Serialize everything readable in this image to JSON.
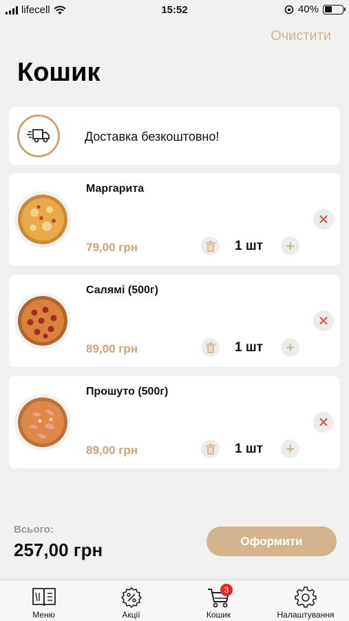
{
  "status": {
    "carrier": "lifecell",
    "time": "15:52",
    "battery": "40%",
    "battery_level": 0.4
  },
  "header": {
    "clear_label": "Очистити",
    "title": "Кошик"
  },
  "delivery": {
    "text": "Доставка безкоштовно!",
    "icon": "delivery-truck-icon"
  },
  "items": [
    {
      "name": "Маргарита",
      "price": "79,00 грн",
      "quantity": "1 шт",
      "style": "margherita"
    },
    {
      "name": "Салямі (500г)",
      "price": "89,00 грн",
      "quantity": "1 шт",
      "style": "salami"
    },
    {
      "name": "Прошуто (500г)",
      "price": "89,00 грн",
      "quantity": "1 шт",
      "style": "prosciutto"
    }
  ],
  "summary": {
    "total_label": "Всього:",
    "total_value": "257,00 грн",
    "checkout_label": "Оформити"
  },
  "tabs": [
    {
      "label": "Меню",
      "icon": "menu-book-icon"
    },
    {
      "label": "Акції",
      "icon": "discount-badge-icon"
    },
    {
      "label": "Кошик",
      "icon": "cart-icon",
      "badge": "3"
    },
    {
      "label": "Налаштування",
      "icon": "gear-icon"
    }
  ],
  "colors": {
    "accent": "#d4b48c",
    "price": "#c9a47a",
    "remove": "#e04848",
    "badge": "#e8252a",
    "background": "#f0f0f0"
  }
}
